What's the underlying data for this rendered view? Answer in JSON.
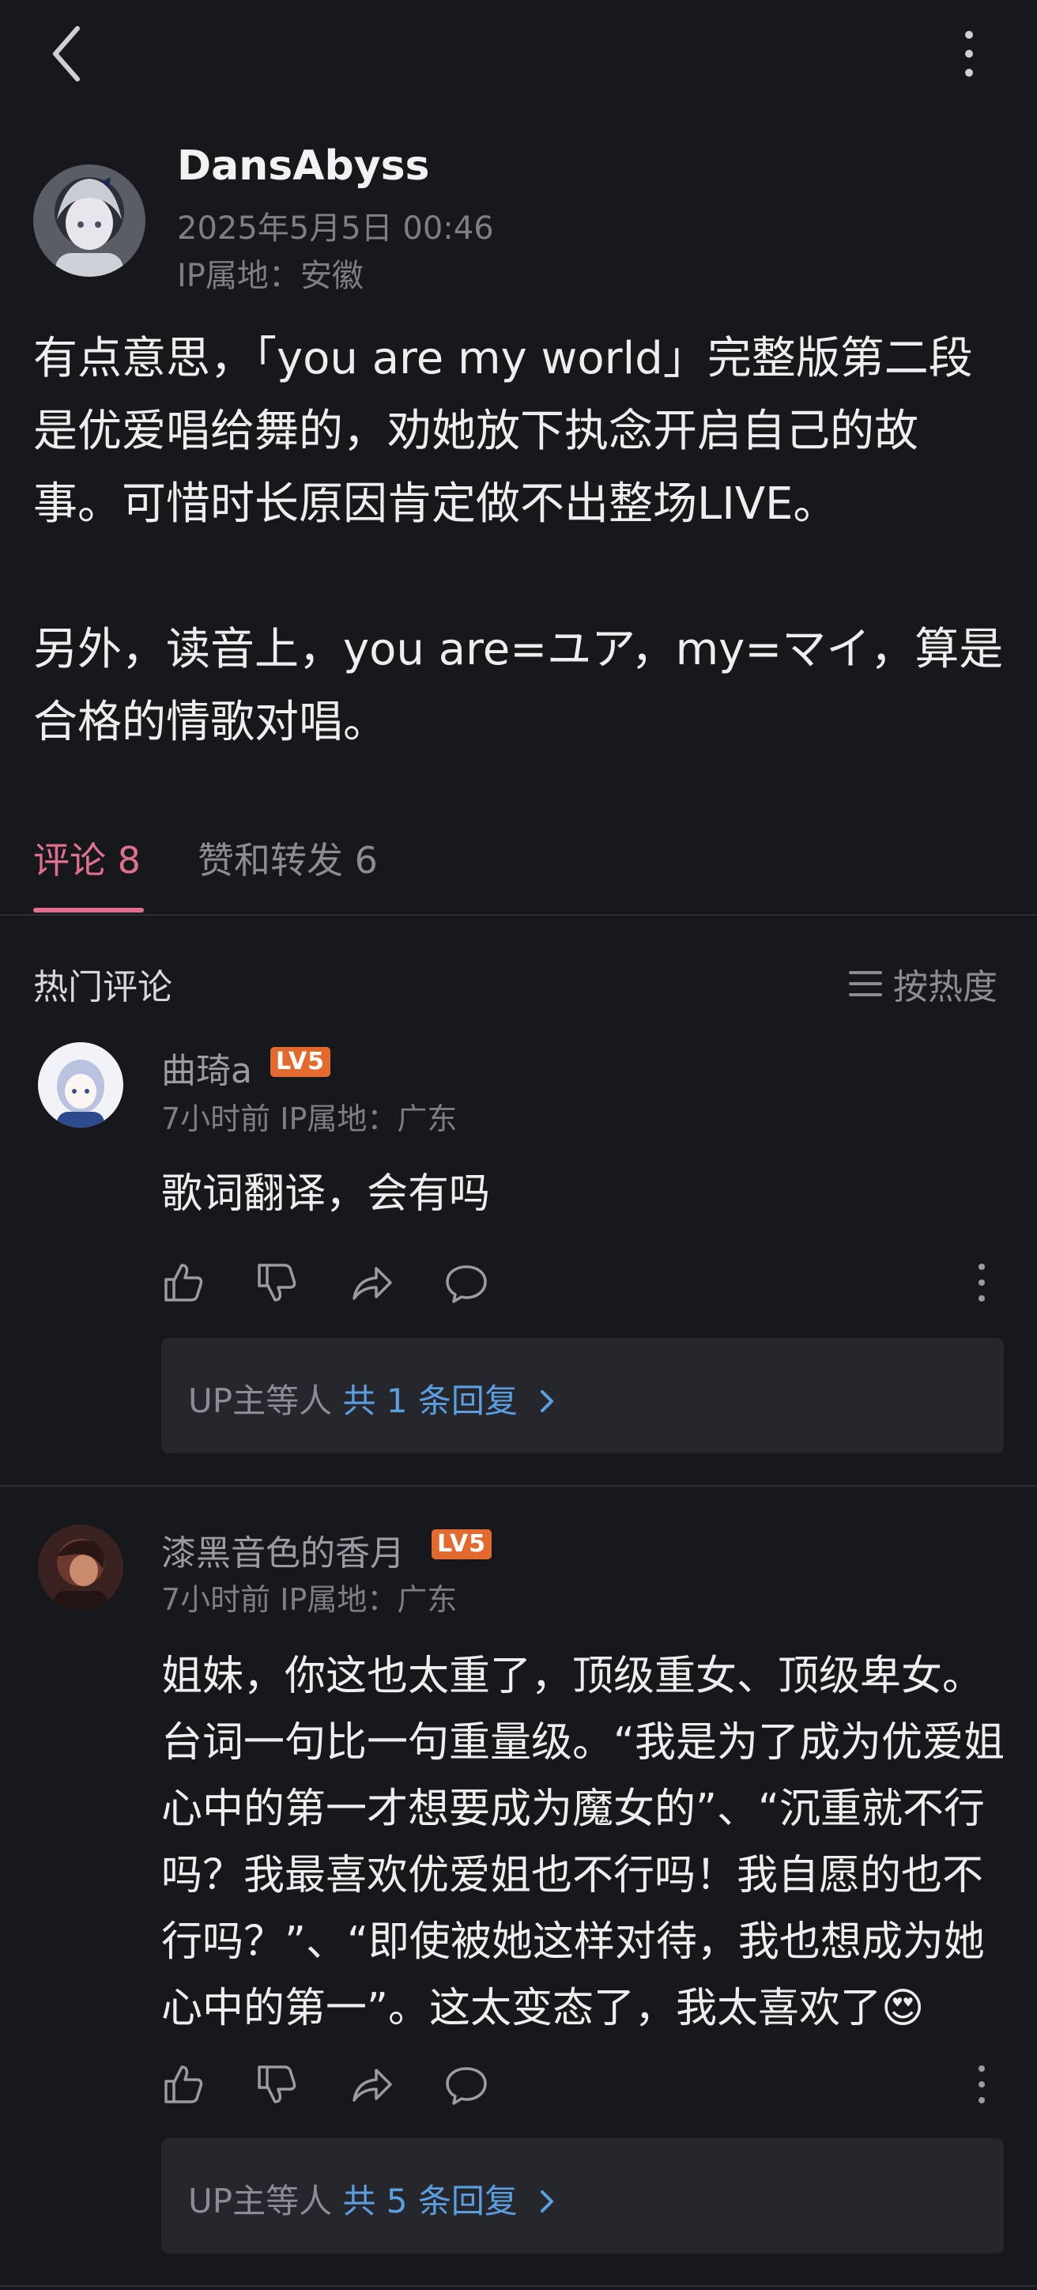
{
  "post": {
    "author": "DansAbyss",
    "date": "2025年5月5日 00:46",
    "ip": "IP属地：安徽",
    "paragraph1": "有点意思，「you are my world」完整版第二段是优爱唱给舞的，劝她放下执念开启自己的故事。可惜时长原因肯定做不出整场LIVE。",
    "paragraph2": "另外，读音上，you are=ユア，my=マイ，算是合格的情歌对唱。"
  },
  "tabs": {
    "comments": "评论 8",
    "likes_reposts": "赞和转发 6"
  },
  "section": {
    "title": "热门评论",
    "sort_label": "按热度"
  },
  "comments": [
    {
      "name": "曲琦a",
      "level": "LV5",
      "meta": "7小时前 IP属地：广东",
      "text": "歌词翻译，会有吗",
      "reply_prefix": "UP主等人",
      "reply_link": "共 1 条回复"
    },
    {
      "name": "漆黑音色的香月",
      "level": "LV5",
      "meta": "7小时前 IP属地：广东",
      "text": "姐妹，你这也太重了，顶级重女、顶级卑女。台词一句比一句重量级。“我是为了成为优爱姐心中的第一才想要成为魔女的”、“沉重就不行吗？我最喜欢优爱姐也不行吗！我自愿的也不行吗？”、“即使被她这样对待，我也想成为她心中的第一”。这太变态了，我太喜欢了😍",
      "reply_prefix": "UP主等人",
      "reply_link": "共 5 条回复"
    }
  ],
  "colors": {
    "background": "#17181c",
    "accent": "#e0708f",
    "link": "#5b9fe0",
    "level_badge": "#e36a2e"
  },
  "icons": {
    "back": "back-arrow-icon",
    "more": "more-vertical-icon",
    "sort": "list-sort-icon",
    "like": "thumbs-up-icon",
    "dislike": "thumbs-down-icon",
    "share": "share-icon",
    "reply": "comment-bubble-icon",
    "chevron": "chevron-right-icon"
  }
}
